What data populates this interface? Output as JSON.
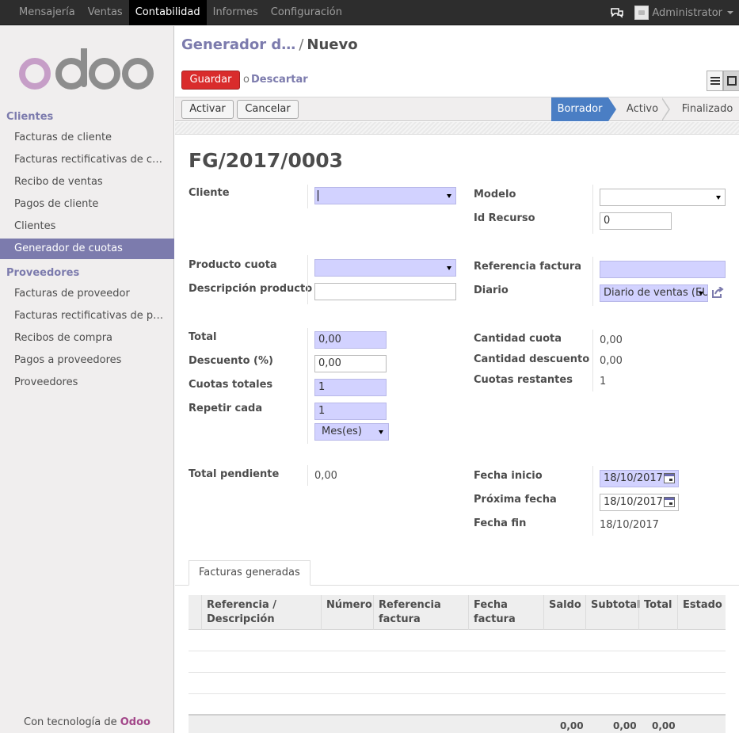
{
  "topbar": {
    "menus": [
      "Mensajería",
      "Ventas",
      "Contabilidad",
      "Informes",
      "Configuración"
    ],
    "active_menu": "Contabilidad",
    "user": "Administrator"
  },
  "sidebar": {
    "section_clientes": "Clientes",
    "clientes_items": [
      "Facturas de cliente",
      "Facturas rectificativas de c…",
      "Recibo de ventas",
      "Pagos de cliente",
      "Clientes",
      "Generador de cuotas"
    ],
    "active_item": "Generador de cuotas",
    "section_proveedores": "Proveedores",
    "proveedores_items": [
      "Facturas de proveedor",
      "Facturas rectificativas de p…",
      "Recibos de compra",
      "Pagos a proveedores",
      "Proveedores"
    ],
    "powered_prefix": "Con tecnología de ",
    "powered_brand": "Odoo"
  },
  "header": {
    "breadcrumb_parent": "Generador d…",
    "breadcrumb_sep": "/",
    "breadcrumb_current": "Nuevo",
    "save_label": "Guardar",
    "or_text": "o",
    "discard_label": "Descartar"
  },
  "statusbar": {
    "activate_label": "Activar",
    "cancel_label": "Cancelar",
    "stages": [
      "Borrador",
      "Activo",
      "Finalizado"
    ],
    "active_stage": "Borrador"
  },
  "form": {
    "title": "FG/2017/0003",
    "cliente_label": "Cliente",
    "cliente_value": "",
    "modelo_label": "Modelo",
    "modelo_value": "",
    "id_recurso_label": "Id Recurso",
    "id_recurso_value": "0",
    "producto_label": "Producto cuota",
    "producto_value": "",
    "descripcion_label": "Descripción producto",
    "descripcion_value": "",
    "referencia_label": "Referencia factura",
    "referencia_value": "",
    "diario_label": "Diario",
    "diario_value": "Diario de ventas (EU",
    "total_label": "Total",
    "total_value": "0,00",
    "descuento_label": "Descuento (%)",
    "descuento_value": "0,00",
    "cuotas_totales_label": "Cuotas totales",
    "cuotas_totales_value": "1",
    "repetir_label": "Repetir cada",
    "repetir_value": "1",
    "periodo_value": "Mes(es)",
    "cantidad_cuota_label": "Cantidad cuota",
    "cantidad_cuota_value": "0,00",
    "cantidad_descuento_label": "Cantidad descuento",
    "cantidad_descuento_value": "0,00",
    "cuotas_restantes_label": "Cuotas restantes",
    "cuotas_restantes_value": "1",
    "total_pendiente_label": "Total pendiente",
    "total_pendiente_value": "0,00",
    "fecha_inicio_label": "Fecha inicio",
    "fecha_inicio_value": "18/10/2017",
    "proxima_fecha_label": "Próxima fecha",
    "proxima_fecha_value": "18/10/2017",
    "fecha_fin_label": "Fecha fin",
    "fecha_fin_value": "18/10/2017"
  },
  "tabs": {
    "facturas_generadas": "Facturas generadas"
  },
  "table": {
    "headers": [
      "Referencia /\nDescripción",
      "Número",
      "Referencia\nfactura",
      "Fecha\nfactura",
      "Saldo",
      "Subtotal",
      "Total",
      "Estado"
    ],
    "footer_saldo": "0,00",
    "footer_subtotal": "0,00",
    "footer_total": "0,00"
  }
}
